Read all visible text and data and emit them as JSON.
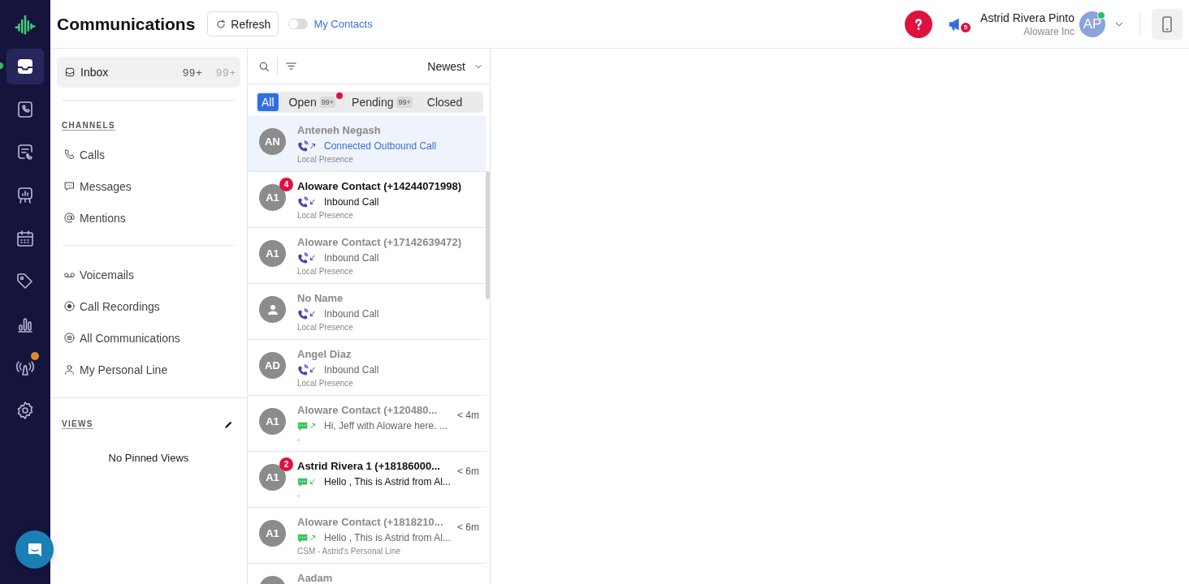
{
  "rail": {
    "items": [
      {
        "kind": "inbox",
        "selected": true,
        "color": "#22c55e"
      },
      {
        "kind": "phone-book",
        "selected": false
      },
      {
        "kind": "chat-phone",
        "selected": false
      },
      {
        "kind": "board",
        "selected": false
      },
      {
        "kind": "calendar",
        "selected": false
      },
      {
        "kind": "tag",
        "selected": false
      },
      {
        "kind": "chart",
        "selected": false
      },
      {
        "kind": "tower",
        "selected": false,
        "color": "#e08a2c"
      },
      {
        "kind": "settings",
        "selected": false
      }
    ]
  },
  "header": {
    "title": "Communications",
    "refresh": "Refresh",
    "my_contacts": {
      "label": "My Contacts",
      "on": false
    },
    "announcements_badge": "5",
    "user": {
      "name": "Astrid Rivera Pinto",
      "company": "Aloware Inc",
      "initials": "AP",
      "online": true
    }
  },
  "sidebar": {
    "inbox": {
      "label": "Inbox",
      "count_1": "99+",
      "count_2": "99+",
      "selected": true
    },
    "channels_heading": "CHANNELS",
    "channels": [
      {
        "kind": "calls",
        "label": "Calls"
      },
      {
        "kind": "messages",
        "label": "Messages"
      },
      {
        "kind": "mentions",
        "label": "Mentions"
      }
    ],
    "more": [
      {
        "kind": "voicemails",
        "label": "Voicemails"
      },
      {
        "kind": "recordings",
        "label": "Call Recordings"
      },
      {
        "kind": "all",
        "label": "All Communications"
      },
      {
        "kind": "personal",
        "label": "My Personal Line"
      }
    ],
    "views_heading": "VIEWS",
    "views_empty": "No Pinned Views"
  },
  "list": {
    "sort": "Newest",
    "tabs": [
      {
        "label": "All",
        "selected": true
      },
      {
        "label": "Open",
        "count": "99+",
        "alert": true,
        "selected": false
      },
      {
        "label": "Pending",
        "count": "99+",
        "alert": false,
        "selected": false
      },
      {
        "label": "Closed",
        "selected": false
      }
    ],
    "rows": [
      {
        "initials": "AN",
        "name": "Anteneh Negash",
        "unread": false,
        "kind": "call",
        "outbound": true,
        "preview": "Connected Outbound Call",
        "connected": true,
        "line": "Local Presence",
        "selected": true
      },
      {
        "initials": "A1",
        "badge": "4",
        "name": "Aloware Contact (+14244071998)",
        "unread": true,
        "kind": "call",
        "outbound": false,
        "connected": false,
        "preview": "Inbound Call",
        "line": "Local Presence",
        "selected": false
      },
      {
        "initials": "A1",
        "name": "Aloware Contact (+17142639472)",
        "unread": false,
        "kind": "call",
        "outbound": false,
        "connected": false,
        "preview": "Inbound Call",
        "line": "Local Presence",
        "selected": false
      },
      {
        "placeholder_avatar": true,
        "name": "No Name",
        "unread": false,
        "kind": "call",
        "outbound": false,
        "connected": false,
        "preview": "Inbound Call",
        "line": "Local Presence",
        "selected": false
      },
      {
        "initials": "AD",
        "name": "Angel Diaz",
        "unread": false,
        "kind": "call",
        "outbound": false,
        "connected": false,
        "preview": "Inbound Call",
        "line": "Local Presence",
        "selected": false
      },
      {
        "initials": "A1",
        "name": "Aloware Contact (+120480...",
        "unread": false,
        "kind": "message",
        "outbound": true,
        "connected": false,
        "preview": "Hi, Jeff with Aloware here. ...",
        "line": "-",
        "time": "< 4m",
        "selected": false
      },
      {
        "initials": "A1",
        "badge": "2",
        "name": "Astrid Rivera 1 (+18186000...",
        "unread": true,
        "kind": "message",
        "outbound": false,
        "connected": false,
        "preview": "Hello , This is Astrid from Al...",
        "line": "-",
        "time": "< 6m",
        "selected": false
      },
      {
        "initials": "A1",
        "name": "Aloware Contact (+1818210...",
        "unread": false,
        "kind": "message",
        "outbound": true,
        "connected": false,
        "preview": "Hello , This is Astrid from Al...",
        "line": "CSM - Astrid's Personal Line",
        "time": "< 6m",
        "selected": false
      },
      {
        "name": "Aadam",
        "unread": false,
        "selected": false
      }
    ]
  }
}
